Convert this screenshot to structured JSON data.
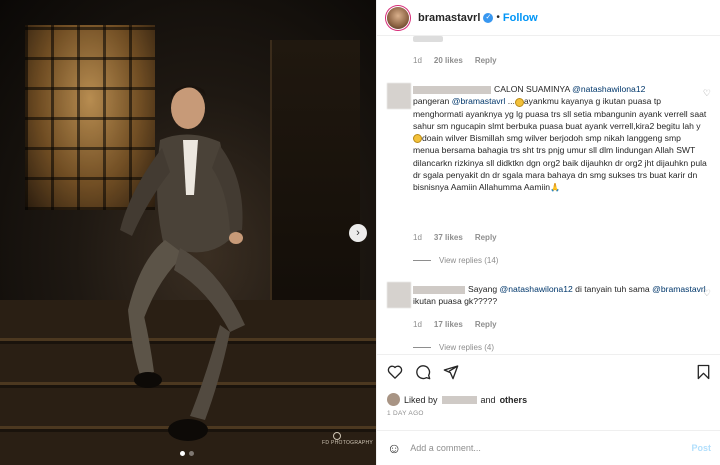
{
  "post": {
    "username": "bramastavrl",
    "verified_icon": "verified-badge-icon",
    "separator": "•",
    "follow_label": "Follow",
    "photo_watermark": "FD PHOTOGRAPHY",
    "carousel_total": 2,
    "carousel_index": 1
  },
  "comments": [
    {
      "meta_time": "1d",
      "meta_likes": "20 likes",
      "meta_reply": "Reply"
    },
    {
      "prefix": "CALON SUAMINYA",
      "mention1": "@natashawilona12",
      "line2_pre": "pangeran",
      "mention2": "@bramastavrl",
      "text_a": "...",
      "text_b": "ayankmu kayanya g ikutan puasa tp menghormati ayanknya yg lg puasa trs sll setia mbangunin ayank verrell saat sahur sm ngucapin slmt berbuka puasa buat ayank verrell,kira2 begitu lah y",
      "text_c": "doain wilver Bismillah smg wilver berjodoh smp nikah langgeng smp menua bersama bahagia trs sht trs pnjg umur sll dlm lindungan Allah SWT dilancarkn rizkinya sll didktkn dgn org2 baik dijauhkn dr org2 jht dijauhkn pula dr sgala penyakit dn dr sgala mara bahaya dn smg sukses trs buat karir dn bisnisnya Aamiin Allahumma Aamiin",
      "meta_time": "1d",
      "meta_likes": "37 likes",
      "meta_reply": "Reply",
      "view_replies": "View replies (14)"
    },
    {
      "text_pre": "Sayang",
      "mention1": "@natashawilona12",
      "text_mid": "di tanyain tuh sama",
      "mention2": "@bramastavrl",
      "text_post": "ikutan puasa gk?????",
      "meta_time": "1d",
      "meta_likes": "17 likes",
      "meta_reply": "Reply",
      "view_replies": "View replies (4)"
    }
  ],
  "likes": {
    "prefix": "Liked by",
    "conj": "and",
    "others": "others"
  },
  "timestamp": "1 DAY AGO",
  "composer": {
    "placeholder": "Add a comment...",
    "post_label": "Post",
    "emoji_icon": "smiley-icon"
  },
  "icons": [
    "heart-icon",
    "comment-icon",
    "share-icon",
    "bookmark-icon",
    "chevron-right-icon"
  ]
}
